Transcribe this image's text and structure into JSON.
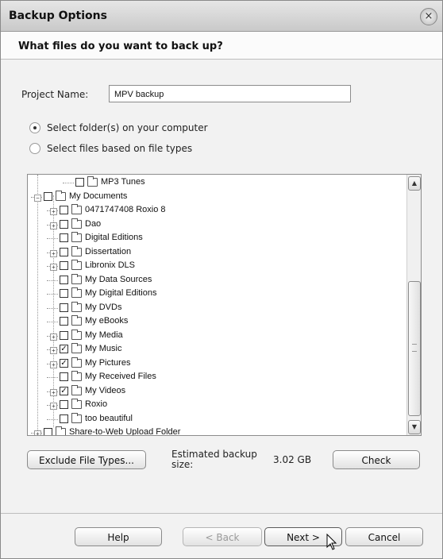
{
  "window": {
    "title": "Backup Options",
    "close_glyph": "×"
  },
  "header": {
    "question": "What files do you want to back up?"
  },
  "project": {
    "label": "Project Name:",
    "value": "MPV backup"
  },
  "options": [
    {
      "label": "Select folder(s) on your computer",
      "selected": true
    },
    {
      "label": "Select files based on file types",
      "selected": false
    }
  ],
  "tree": {
    "items": [
      {
        "label": "MP3 Tunes",
        "checked": false,
        "expander": "",
        "icon": "folder-icon"
      },
      {
        "label": "My Documents",
        "checked": false,
        "expander": "−",
        "icon": "documents-folder-icon"
      },
      {
        "label": "0471747408 Roxio 8",
        "checked": false,
        "expander": "+",
        "icon": "folder-icon"
      },
      {
        "label": "Dao",
        "checked": false,
        "expander": "+",
        "icon": "folder-icon"
      },
      {
        "label": "Digital Editions",
        "checked": false,
        "expander": "",
        "icon": "folder-icon"
      },
      {
        "label": "Dissertation",
        "checked": false,
        "expander": "+",
        "icon": "folder-icon"
      },
      {
        "label": "Libronix DLS",
        "checked": false,
        "expander": "+",
        "icon": "folder-icon"
      },
      {
        "label": "My Data Sources",
        "checked": false,
        "expander": "",
        "icon": "data-sources-folder-icon"
      },
      {
        "label": "My Digital Editions",
        "checked": false,
        "expander": "",
        "icon": "folder-icon"
      },
      {
        "label": "My DVDs",
        "checked": false,
        "expander": "",
        "icon": "folder-icon"
      },
      {
        "label": "My eBooks",
        "checked": false,
        "expander": "",
        "icon": "folder-icon"
      },
      {
        "label": "My Media",
        "checked": false,
        "expander": "+",
        "icon": "folder-icon"
      },
      {
        "label": "My Music",
        "checked": true,
        "expander": "+",
        "icon": "music-folder-icon"
      },
      {
        "label": "My Pictures",
        "checked": true,
        "expander": "+",
        "icon": "pictures-folder-icon"
      },
      {
        "label": "My Received Files",
        "checked": false,
        "expander": "",
        "icon": "folder-icon"
      },
      {
        "label": "My Videos",
        "checked": true,
        "expander": "+",
        "icon": "videos-folder-icon"
      },
      {
        "label": "Roxio",
        "checked": false,
        "expander": "+",
        "icon": "folder-icon"
      },
      {
        "label": "too beautiful",
        "checked": false,
        "expander": "",
        "icon": "folder-icon"
      },
      {
        "label": "Share-to-Web Upload Folder",
        "checked": false,
        "expander": "+",
        "icon": "share-folder-icon"
      }
    ]
  },
  "actions": {
    "exclude_label": "Exclude File Types...",
    "estimate_label": "Estimated backup size:",
    "estimate_value": "3.02 GB",
    "check_label": "Check"
  },
  "footer": {
    "help_label": "Help",
    "back_label": "< Back",
    "next_label": "Next >",
    "cancel_label": "Cancel"
  }
}
